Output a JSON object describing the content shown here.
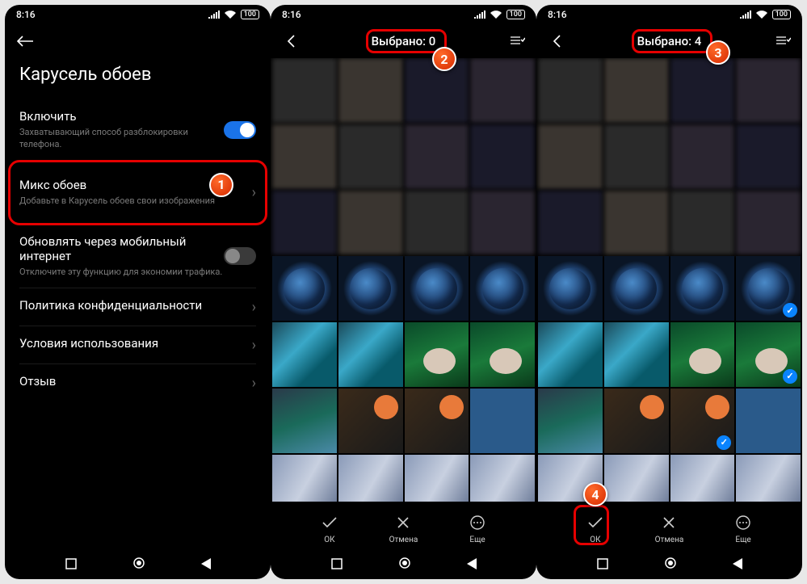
{
  "status": {
    "time": "8:16",
    "battery": "100"
  },
  "screen1": {
    "title": "Карусель обоев",
    "enable": {
      "label": "Включить",
      "desc": "Захватывающий способ разблокировки телефона."
    },
    "mix": {
      "label": "Микс обоев",
      "desc": "Добавьте в Карусель обоев свои изображения"
    },
    "mobile": {
      "label": "Обновлять через мобильный интернет",
      "desc": "Отключите эту функцию для экономии трафика."
    },
    "privacy": "Политика конфиденциальности",
    "terms": "Условия использования",
    "feedback": "Отзыв"
  },
  "screen2": {
    "header": "Выбрано: 0"
  },
  "screen3": {
    "header": "Выбрано: 4"
  },
  "actions": {
    "ok": "ОК",
    "cancel": "Отмена",
    "more": "Еще"
  },
  "markers": {
    "m1": "1",
    "m2": "2",
    "m3": "3",
    "m4": "4"
  }
}
